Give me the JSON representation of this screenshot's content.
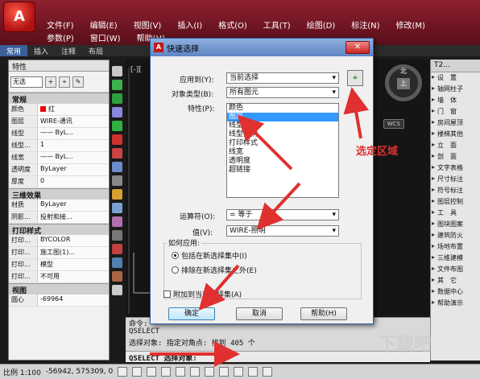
{
  "app": {
    "menu_row1": [
      "文件(F)",
      "编辑(E)",
      "视图(V)",
      "插入(I)",
      "格式(O)",
      "工具(T)",
      "绘图(D)",
      "标注(N)",
      "修改(M)"
    ],
    "menu_row2": [
      "参数(P)",
      "窗口(W)",
      "帮助(H)"
    ],
    "ribbon_tabs": [
      "常用",
      "插入",
      "注释",
      "布局"
    ],
    "accent": "#3a5f9a"
  },
  "left_panel": {
    "title": "特性",
    "selector": "无选",
    "general_title": "常规",
    "general": [
      {
        "k": "颜色",
        "v": "红"
      },
      {
        "k": "图层",
        "v": "WIRE-通讯"
      },
      {
        "k": "线型",
        "v": "—— ByL..."
      },
      {
        "k": "线型...",
        "v": "1"
      },
      {
        "k": "线宽",
        "v": "—— ByL..."
      },
      {
        "k": "透明度",
        "v": "ByLayer"
      },
      {
        "k": "厚度",
        "v": "0"
      }
    ],
    "threed_title": "三维效果",
    "threed": [
      {
        "k": "材质",
        "v": "ByLayer"
      },
      {
        "k": "阴影...",
        "v": "投射和接..."
      }
    ],
    "print_title": "打印样式",
    "print": [
      {
        "k": "打印...",
        "v": "BYCOLOR"
      },
      {
        "k": "打印...",
        "v": "施工图(1)..."
      },
      {
        "k": "打印...",
        "v": "模型"
      },
      {
        "k": "打印...",
        "v": "不可用"
      }
    ],
    "view_title": "视图",
    "view": [
      {
        "k": "圆心",
        "v": "-69964"
      }
    ]
  },
  "drawing": {
    "label": "[-][",
    "compass_top": "北",
    "compass_center": "上",
    "wcs": "WCS"
  },
  "right_panel": {
    "title": "T2...",
    "items": [
      "设　置",
      "轴网柱子",
      "墙　体",
      "门　窗",
      "房间屋顶",
      "楼梯其他",
      "立　面",
      "剖　面",
      "文字表格",
      "尺寸标注",
      "符号标注",
      "图层控制",
      "工　具",
      "图块图案",
      "建筑防火",
      "场地布置",
      "三维建模",
      "文件布图",
      "其　它",
      "数据中心",
      "帮助演示"
    ]
  },
  "command": {
    "line1": "命令:",
    "line2": "QSELECT",
    "line3": "选择对象: 指定对角点: 找到 405 个",
    "prompt": "QSELECT 选择对象:"
  },
  "status": {
    "scale": "比例 1:100",
    "coords": "-56942, 575309, 0"
  },
  "dialog": {
    "title": "快速选择",
    "close": "✕",
    "apply_label": "应用到(Y):",
    "apply_value": "当前选择",
    "objtype_label": "对象类型(B):",
    "objtype_value": "所有图元",
    "props_label": "特性(P):",
    "props": [
      "颜色",
      "图层",
      "线型",
      "线型比例",
      "打印样式",
      "线宽",
      "透明度",
      "超链接"
    ],
    "props_selected": 1,
    "operator_label": "运算符(O):",
    "operator_value": "= 等于",
    "value_label": "值(V):",
    "value_value": "WIRE-照明",
    "how_label": "如何应用:",
    "radio_include": "包括在新选择集中(I)",
    "radio_exclude": "排除在新选择集之外(E)",
    "append_label": "附加到当前选择集(A)",
    "ok": "确定",
    "cancel": "取消",
    "help": "帮助(H)"
  },
  "annotation": {
    "text": "选定区域",
    "color": "#e03030"
  },
  "watermark": "下载吧"
}
